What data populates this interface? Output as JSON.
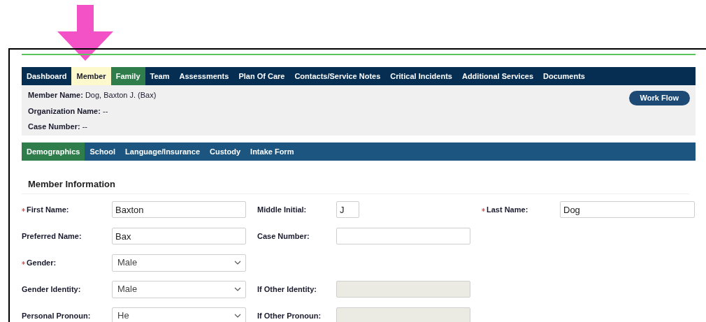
{
  "main_tabs": [
    {
      "label": "Dashboard",
      "selected": false,
      "highlighted": false
    },
    {
      "label": "Member",
      "selected": true,
      "highlighted": false
    },
    {
      "label": "Family",
      "selected": false,
      "highlighted": true
    },
    {
      "label": "Team",
      "selected": false,
      "highlighted": false
    },
    {
      "label": "Assessments",
      "selected": false,
      "highlighted": false
    },
    {
      "label": "Plan Of Care",
      "selected": false,
      "highlighted": false
    },
    {
      "label": "Contacts/Service Notes",
      "selected": false,
      "highlighted": false
    },
    {
      "label": "Critical Incidents",
      "selected": false,
      "highlighted": false
    },
    {
      "label": "Additional Services",
      "selected": false,
      "highlighted": false
    },
    {
      "label": "Documents",
      "selected": false,
      "highlighted": false
    }
  ],
  "member_summary": [
    {
      "label": "Member Name:",
      "value": "Dog, Baxton J. (Bax)"
    },
    {
      "label": "Organization Name:",
      "value": "--"
    },
    {
      "label": "Case Number:",
      "value": "--"
    }
  ],
  "workflow_button": "Work Flow",
  "sub_tabs": [
    {
      "label": "Demographics",
      "selected": true
    },
    {
      "label": "School",
      "selected": false
    },
    {
      "label": "Language/Insurance",
      "selected": false
    },
    {
      "label": "Custody",
      "selected": false
    },
    {
      "label": "Intake Form",
      "selected": false
    }
  ],
  "section_title": "Member Information",
  "form_rows": [
    [
      {
        "label": "First Name:",
        "required": true,
        "kind": "text",
        "value": "Baxton"
      },
      {
        "label": "Middle Initial:",
        "required": false,
        "kind": "short",
        "value": "J"
      },
      {
        "label": "Last Name:",
        "required": true,
        "kind": "text",
        "value": "Dog"
      }
    ],
    [
      {
        "label": "Preferred Name:",
        "required": false,
        "kind": "text",
        "value": "Bax"
      },
      {
        "label": "Case Number:",
        "required": false,
        "kind": "text"
      }
    ],
    [
      {
        "label": "Gender:",
        "required": true,
        "kind": "select",
        "value": "Male"
      }
    ],
    [
      {
        "label": "Gender Identity:",
        "required": false,
        "kind": "select",
        "value": "Male"
      },
      {
        "label": "If Other Identity:",
        "required": false,
        "kind": "disabled"
      }
    ],
    [
      {
        "label": "Personal Pronoun:",
        "required": false,
        "kind": "select",
        "value": "He"
      },
      {
        "label": "If Other Pronoun:",
        "required": false,
        "kind": "disabled"
      }
    ]
  ]
}
